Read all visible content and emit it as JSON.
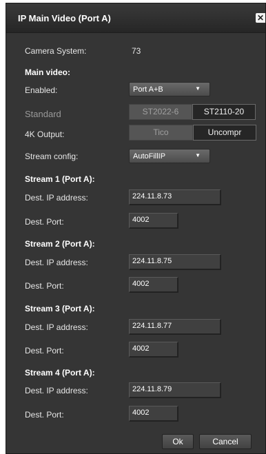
{
  "dialog": {
    "title": "IP Main Video (Port A)",
    "close_glyph": "✕"
  },
  "camera_system": {
    "label": "Camera System:",
    "value": "73"
  },
  "main_video": {
    "heading": "Main video:",
    "enabled_label": "Enabled:",
    "enabled_value": "Port A+B",
    "standard_label": "Standard",
    "standard_options": [
      "ST2022-6",
      "ST2110-20"
    ],
    "standard_selected": "ST2110-20",
    "output_4k_label": "4K Output:",
    "output_4k_options": [
      "Tico",
      "Uncompr"
    ],
    "output_4k_selected": "Uncompr",
    "stream_config_label": "Stream config:",
    "stream_config_value": "AutoFillIP",
    "dropdown_arrow_icon": "triangle-down"
  },
  "streams": [
    {
      "heading": "Stream 1 (Port A):",
      "ip_label": "Dest. IP address:",
      "ip": "224.11.8.73",
      "port_label": "Dest. Port:",
      "port": "4002"
    },
    {
      "heading": "Stream 2 (Port A):",
      "ip_label": "Dest. IP address:",
      "ip": "224.11.8.75",
      "port_label": "Dest. Port:",
      "port": "4002"
    },
    {
      "heading": "Stream 3 (Port A):",
      "ip_label": "Dest. IP address:",
      "ip": "224.11.8.77",
      "port_label": "Dest. Port:",
      "port": "4002"
    },
    {
      "heading": "Stream 4 (Port A):",
      "ip_label": "Dest. IP address:",
      "ip": "224.11.8.79",
      "port_label": "Dest. Port:",
      "port": "4002"
    }
  ],
  "footer": {
    "ok_label": "Ok",
    "cancel_label": "Cancel"
  }
}
